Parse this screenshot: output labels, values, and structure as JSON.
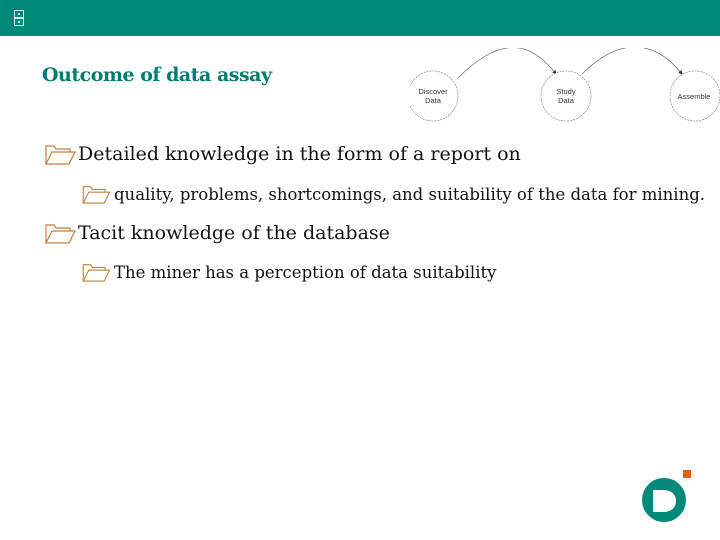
{
  "topbar": {
    "icon": "window-control-icon",
    "color": "#008878"
  },
  "slide": {
    "title": "Outcome of data assay",
    "title_color": "#007d70",
    "bullet_icon": "folder-open-icon",
    "bullet_color": "#c0803a",
    "bullets": [
      {
        "level": 1,
        "text": "Detailed knowledge in the form of a report on"
      },
      {
        "level": 2,
        "text": "quality, problems, shortcomings, and suitability of the data for mining."
      },
      {
        "level": 1,
        "text": "Tacit knowledge of the database"
      },
      {
        "level": 2,
        "text": "The miner has a perception of data suitability"
      }
    ]
  },
  "diagram": {
    "nodes": [
      {
        "line1": "Discover",
        "line2": "Data"
      },
      {
        "line1": "Study",
        "line2": "Data"
      },
      {
        "line1": "Assemble",
        "line2": ""
      }
    ]
  },
  "logo": {
    "name": "brand-logo",
    "primary": "#008878",
    "accent": "#e06010"
  }
}
